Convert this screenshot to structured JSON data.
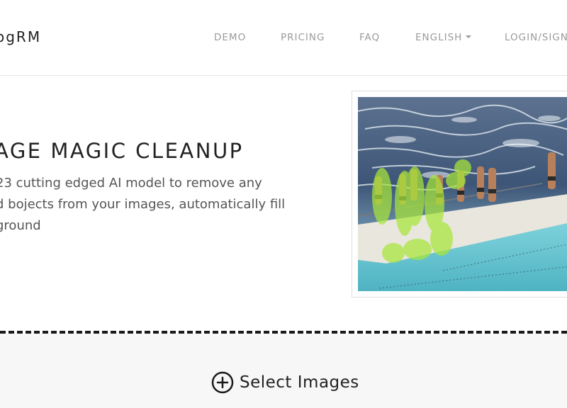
{
  "header": {
    "brand": "ogRM",
    "nav": {
      "demo": "DEMO",
      "pricing": "PRICING",
      "faq": "FAQ",
      "language": "ENGLISH",
      "login": "LOGIN/SIGN"
    }
  },
  "hero": {
    "title": "AGE MAGIC CLEANUP",
    "description_lines": [
      "23 cutting edged AI model to remove any",
      "d bojects from your images, automatically fill",
      "ground"
    ]
  },
  "upload": {
    "select_label": "Select Images"
  },
  "colors": {
    "highlight": "#a8e63a",
    "divider": "#1a1a1a",
    "upload_bg": "#f7f7f7"
  }
}
